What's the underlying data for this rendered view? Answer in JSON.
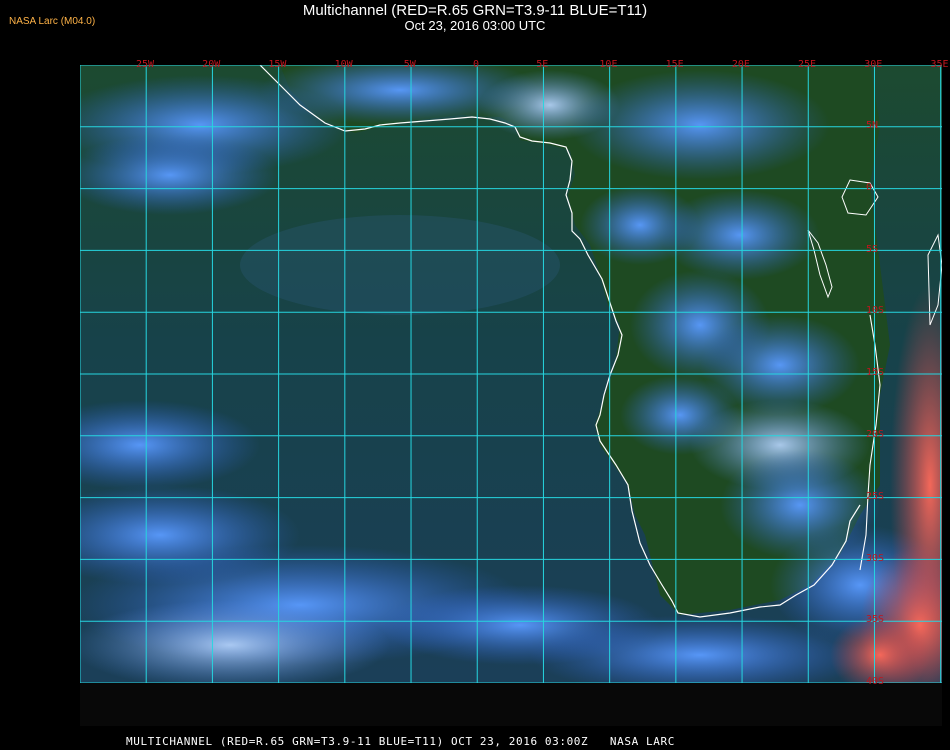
{
  "header": {
    "title": "Multichannel (RED=R.65 GRN=T3.9-11 BLUE=T11)",
    "subtitle": "Oct 23, 2016 03:00 UTC",
    "tag": "NASA Larc (M04.0)"
  },
  "footer": {
    "text": "MULTICHANNEL (RED=R.65 GRN=T3.9-11 BLUE=T11) OCT 23, 2016 03:00Z   NASA LARC"
  },
  "grid": {
    "lon_labels": [
      "25W",
      "20W",
      "15W",
      "10W",
      "5W",
      "0",
      "5E",
      "10E",
      "15E",
      "20E",
      "25E",
      "30E",
      "35E"
    ],
    "lat_labels": [
      "5N",
      "0",
      "5S",
      "10S",
      "15S",
      "20S",
      "25S",
      "30S",
      "35S",
      "40S"
    ]
  },
  "colors": {
    "grid": "#26d6e0",
    "coast": "#ffffff",
    "label": "#c0161e",
    "ocean": "#1b3a3f",
    "cloud": "#3a7be8",
    "land": "#1f4a20",
    "hotspot": "#e8524f"
  }
}
